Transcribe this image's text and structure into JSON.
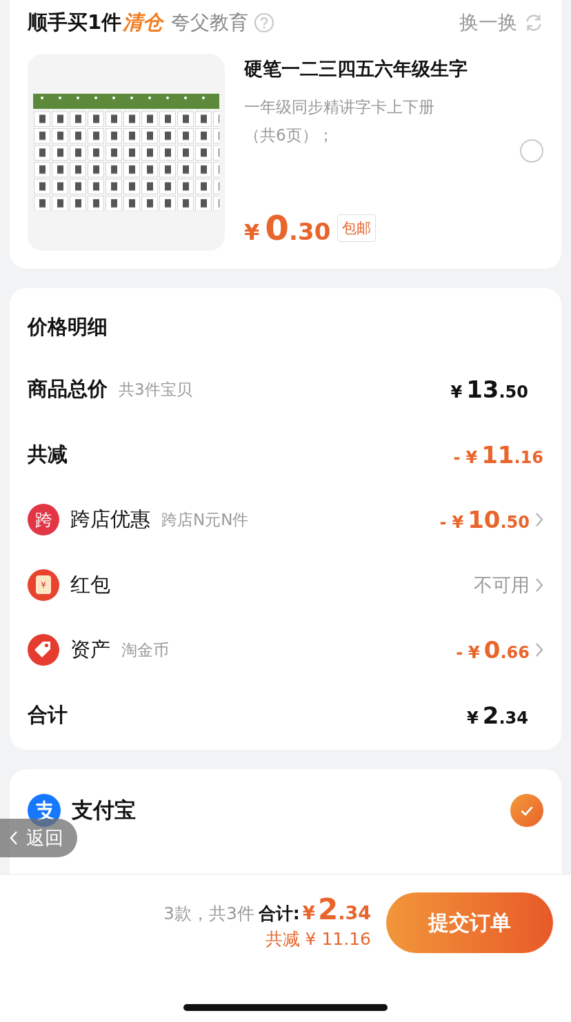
{
  "addon": {
    "title": "顺手买1件",
    "tag": "清仓",
    "shop": "夸父教育",
    "swap": "换一换",
    "product": {
      "kind": "picture",
      "name": "硬笔一二三四五六年级生字",
      "desc": "一年级同步精讲字卡上下册",
      "desc2": "（共6页）；",
      "selected": false,
      "price": {
        "currency": "¥",
        "integer": "0",
        "decimal": ".30"
      },
      "badge": "包邮"
    }
  },
  "price_detail": {
    "title": "价格明细",
    "rows": [
      {
        "kind": "total",
        "label": "商品总价",
        "note": "共3件宝贝",
        "price": {
          "currency": "¥",
          "integer": "13",
          "decimal": ".50"
        }
      },
      {
        "kind": "reduction",
        "label": "共减",
        "price": {
          "sign": "-",
          "currency": "¥",
          "integer": "11",
          "decimal": ".16"
        }
      },
      {
        "kind": "promo",
        "icon_text": "跨",
        "label": "跨店优惠",
        "note": "跨店N元N件",
        "price": {
          "sign": "-",
          "currency": "¥",
          "integer": "10",
          "decimal": ".50"
        }
      },
      {
        "kind": "envelope",
        "icon_text": "¥",
        "label": "红包",
        "value": "不可用"
      },
      {
        "kind": "asset",
        "label": "资产",
        "note": "淘金币",
        "price": {
          "sign": "-",
          "currency": "¥",
          "integer": "0",
          "decimal": ".66"
        }
      },
      {
        "kind": "total",
        "label": "合计",
        "price": {
          "currency": "¥",
          "integer": "2",
          "decimal": ".34"
        }
      }
    ]
  },
  "payment": {
    "methods": [
      {
        "name": "支付宝",
        "selected": true
      }
    ]
  },
  "back_button": "返回",
  "footer": {
    "count": "3款，共3件",
    "total_label": "合计:",
    "total": {
      "currency": "¥",
      "integer": "2",
      "decimal": ".34"
    },
    "saved": "共减 ¥ 11.16",
    "submit": "提交订单"
  }
}
